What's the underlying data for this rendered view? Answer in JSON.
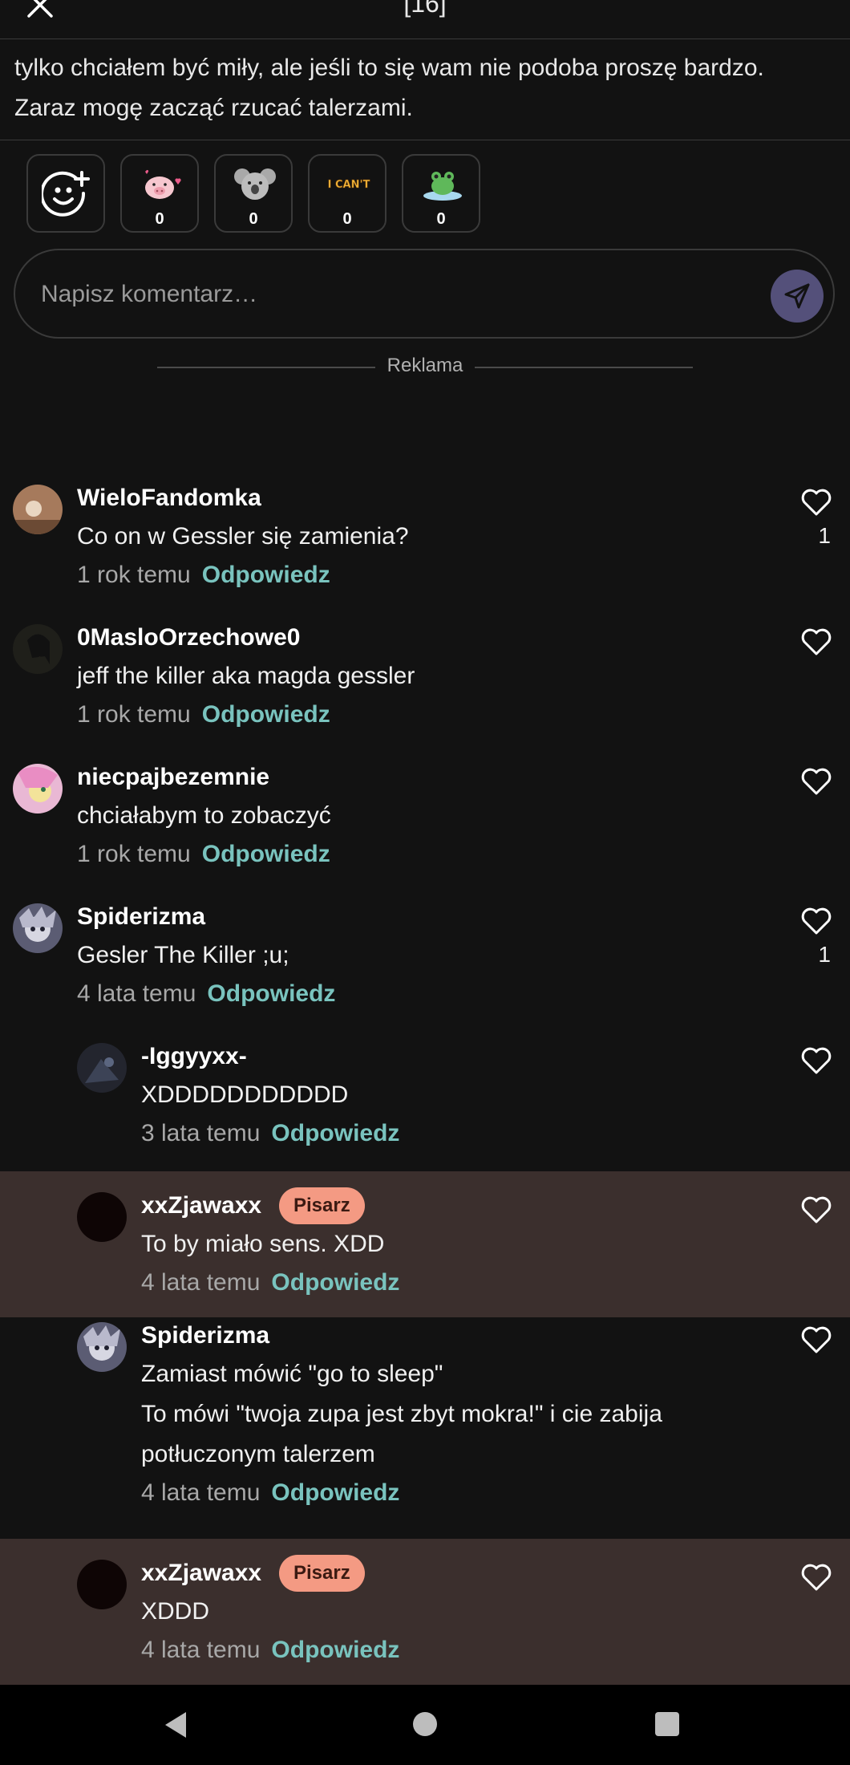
{
  "header": {
    "chapter": "[16]"
  },
  "story": {
    "line1": "tylko chciałem być miły, ale jeśli to się wam nie podoba proszę bardzo.",
    "line2": "Zaraz mogę zacząć rzucać talerzami."
  },
  "reactions": [
    {
      "icon": "pig-heart-icon",
      "count": "0"
    },
    {
      "icon": "koala-icon",
      "count": "0"
    },
    {
      "icon": "i-cant-sticker-icon",
      "count": "0",
      "sticker_text": "I CAN'T"
    },
    {
      "icon": "frog-icon",
      "count": "0"
    }
  ],
  "comment_box": {
    "placeholder": "Napisz komentarz…"
  },
  "ad": {
    "label": "Reklama"
  },
  "comments": [
    {
      "user": "WieloFandomka",
      "text": [
        "Co on w Gessler się zamienia?"
      ],
      "time": "1 rok temu",
      "reply": "Odpowiedz",
      "likes": "1"
    },
    {
      "user": "0MasloOrzechowe0",
      "text": [
        "jeff the killer aka magda gessler"
      ],
      "time": "1 rok temu",
      "reply": "Odpowiedz",
      "likes": ""
    },
    {
      "user": "niecpajbezemnie",
      "text": [
        "chciałabym to zobaczyć"
      ],
      "time": "1 rok temu",
      "reply": "Odpowiedz",
      "likes": ""
    },
    {
      "user": "Spiderizma",
      "text": [
        "Gesler The Killer ;u;"
      ],
      "time": "4 lata temu",
      "reply": "Odpowiedz",
      "likes": "1"
    },
    {
      "user": "-Iggyyxx-",
      "text": [
        "XDDDDDDDDDDD"
      ],
      "time": "3 lata temu",
      "reply": "Odpowiedz",
      "likes": ""
    },
    {
      "user": "xxZjawaxx",
      "badge": "Pisarz",
      "text": [
        "To by miało sens. XDD"
      ],
      "time": "4 lata temu",
      "reply": "Odpowiedz",
      "likes": ""
    },
    {
      "user": "Spiderizma",
      "text": [
        "Zamiast mówić \"go to sleep\"",
        "To mówi \"twoja zupa jest zbyt mokra!\" i cie zabija",
        "potłuczonym talerzem"
      ],
      "time": "4 lata temu",
      "reply": "Odpowiedz",
      "likes": ""
    },
    {
      "user": "xxZjawaxx",
      "badge": "Pisarz",
      "text": [
        "XDDD"
      ],
      "time": "4 lata temu",
      "reply": "Odpowiedz",
      "likes": ""
    }
  ],
  "colors": {
    "background": "#121212",
    "highlight": "#3b2f2d",
    "reply": "#79c3be",
    "badge": "#f49a83",
    "send": "#54507a"
  }
}
